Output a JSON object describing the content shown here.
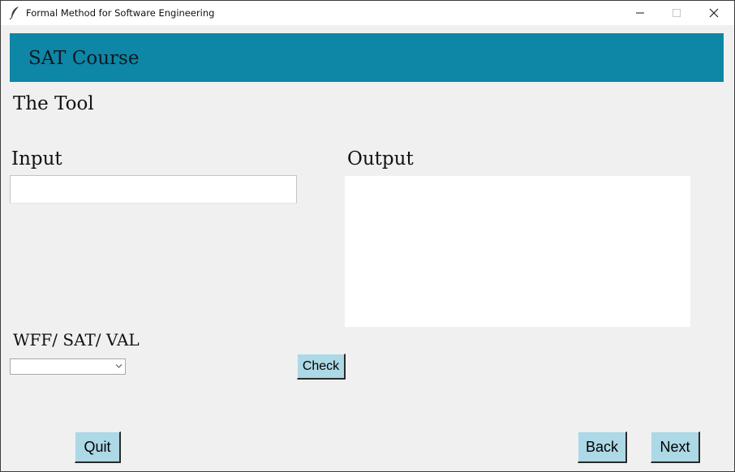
{
  "window": {
    "title": "Formal Method for Software Engineering",
    "app_icon": "feather-icon",
    "controls": [
      "minimize-icon",
      "maximize-icon",
      "close-icon"
    ]
  },
  "header": {
    "title": "SAT Course",
    "background_color": "#0e86a5"
  },
  "tool": {
    "heading": "The Tool"
  },
  "input": {
    "label": "Input",
    "value": "",
    "placeholder": ""
  },
  "output": {
    "label": "Output",
    "value": ""
  },
  "mode": {
    "label": "WFF/ SAT/ VAL",
    "selected": ""
  },
  "buttons": {
    "check": "Check",
    "quit": "Quit",
    "back": "Back",
    "next": "Next",
    "background_color": "#add8e6"
  }
}
